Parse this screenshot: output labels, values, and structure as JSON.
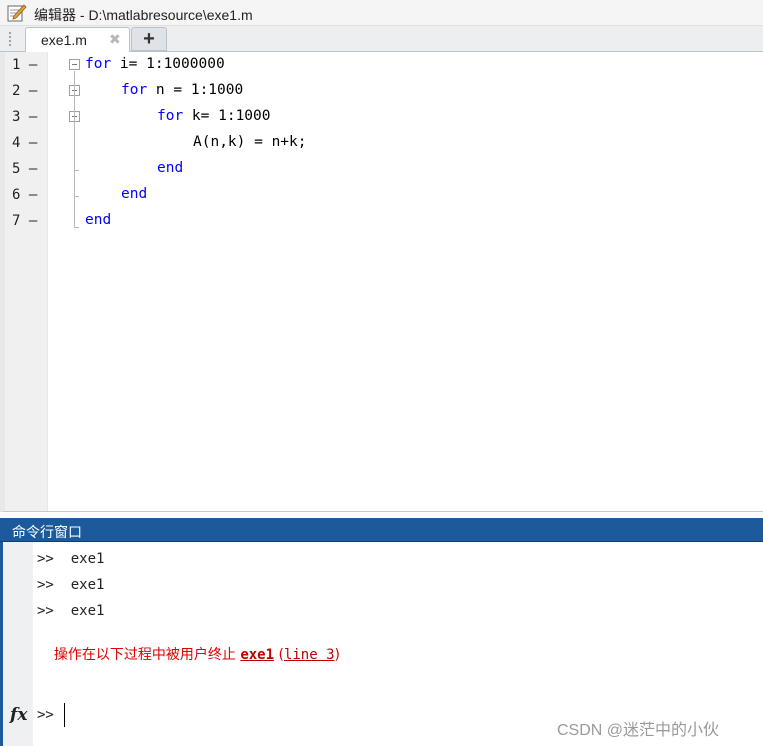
{
  "titlebar": {
    "icon": "editor-pencil-icon",
    "title": "编辑器 - D:\\matlabresource\\exe1.m"
  },
  "tabs": {
    "active_label": "exe1.m",
    "close_glyph": "✖",
    "add_glyph": "+"
  },
  "editor": {
    "line_numbers": [
      "1",
      "2",
      "3",
      "4",
      "5",
      "6",
      "7"
    ],
    "line_marker": "—",
    "lines": [
      {
        "kw": "for",
        "rest": " i= 1:1000000"
      },
      {
        "kw": "for",
        "rest": " n = 1:1000"
      },
      {
        "kw": "for",
        "rest": " k= 1:1000"
      },
      {
        "kw": "",
        "rest": "A(n,k) = n+k;"
      },
      {
        "kw": "end",
        "rest": ""
      },
      {
        "kw": "end",
        "rest": ""
      },
      {
        "kw": "end",
        "rest": ""
      }
    ],
    "colors": {
      "keyword": "#0000ff",
      "text": "#000000"
    }
  },
  "command_window": {
    "title": "命令行窗口",
    "history": [
      ">>  exe1",
      ">>  exe1",
      ">>  exe1"
    ],
    "error": {
      "message": "操作在以下过程中被用户终止 ",
      "link": "exe1",
      "paren_open": " (",
      "line_ref": "line 3",
      "paren_close": ")"
    },
    "fx_label": "fx",
    "prompt": ">>",
    "accent_color": "#1c5a9c",
    "error_color": "#e00000"
  },
  "watermark": "CSDN @迷茫中的小伙"
}
